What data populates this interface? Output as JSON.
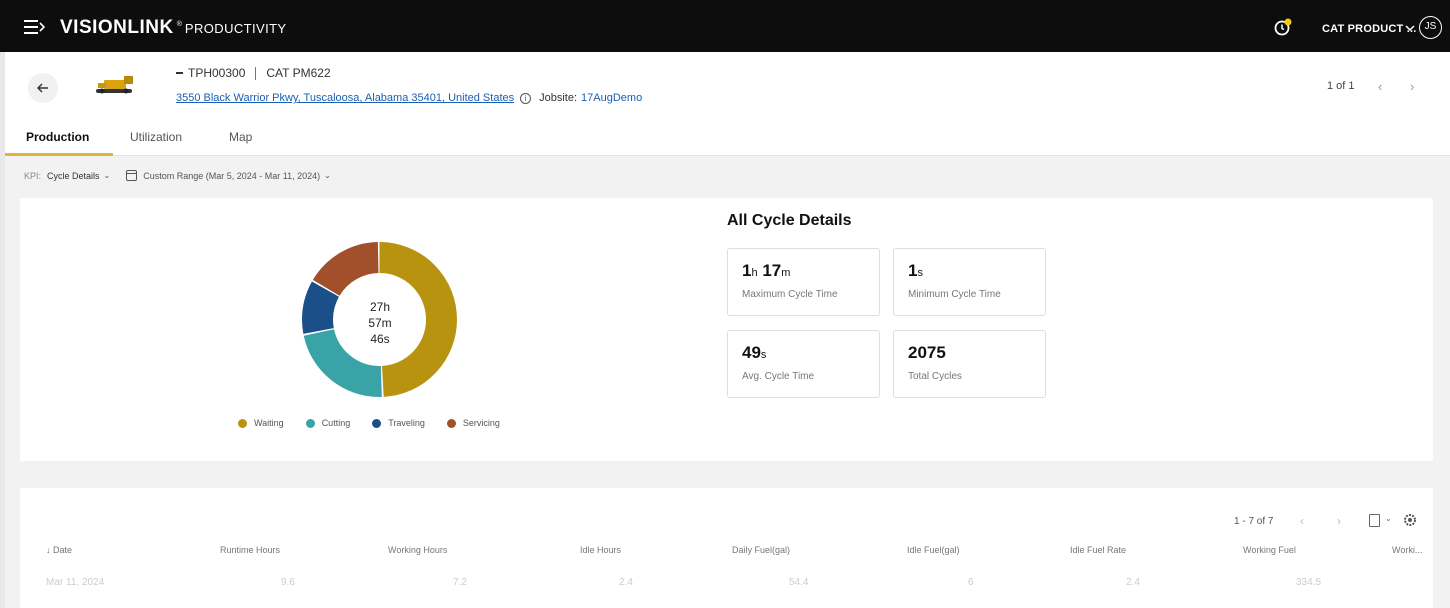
{
  "header": {
    "brand_logo": "VISIONLINK",
    "brand_reg": "®",
    "brand_product": "PRODUCTIVITY",
    "account_name": "CAT PRODUCT ...",
    "avatar_initials": "JS"
  },
  "asset": {
    "serial": "TPH00300",
    "model": "CAT PM622",
    "address": "3550 Black Warrior Pkwy, Tuscaloosa, Alabama 35401, United States",
    "jobsite_label": "Jobsite:",
    "jobsite_value": "17AugDemo",
    "pager": "1 of 1"
  },
  "tabs": [
    {
      "label": "Production",
      "active": true
    },
    {
      "label": "Utilization",
      "active": false
    },
    {
      "label": "Map",
      "active": false
    }
  ],
  "filters": {
    "kpi_label": "KPI:",
    "kpi_value": "Cycle Details",
    "date_range": "Custom Range (Mar 5, 2024 - Mar 11, 2024)"
  },
  "chart_data": {
    "type": "pie",
    "center_label": [
      "27h",
      "57m",
      "46s"
    ],
    "series": [
      {
        "name": "Waiting",
        "value": 49.5,
        "color": "#b8930f"
      },
      {
        "name": "Cutting",
        "value": 22.5,
        "color": "#3aa3a7"
      },
      {
        "name": "Traveling",
        "value": 11.5,
        "color": "#1b4f8a"
      },
      {
        "name": "Servicing",
        "value": 16.5,
        "color": "#a24f2b"
      }
    ]
  },
  "cycle_details": {
    "title": "All Cycle Details",
    "stats": [
      {
        "v1": "1",
        "u1": "h",
        "v2": "17",
        "u2": "m",
        "label": "Maximum Cycle Time"
      },
      {
        "v1": "1",
        "u1": "s",
        "v2": "",
        "u2": "",
        "label": "Minimum Cycle Time"
      },
      {
        "v1": "49",
        "u1": "s",
        "v2": "",
        "u2": "",
        "label": "Avg. Cycle Time"
      },
      {
        "v1": "2075",
        "u1": "",
        "v2": "",
        "u2": "",
        "label": "Total Cycles"
      }
    ]
  },
  "table": {
    "pager": "1 - 7 of 7",
    "sort_arrow": "↓",
    "headers": [
      "Date",
      "Runtime Hours",
      "Working Hours",
      "Idle Hours",
      "Daily Fuel(gal)",
      "Idle Fuel(gal)",
      "Idle Fuel Rate",
      "Working Fuel",
      "Worki..."
    ],
    "rows": [
      [
        "Mar 11, 2024",
        "9.6",
        "7.2",
        "2.4",
        "54.4",
        "6",
        "2.4",
        "334.5",
        ""
      ]
    ]
  }
}
